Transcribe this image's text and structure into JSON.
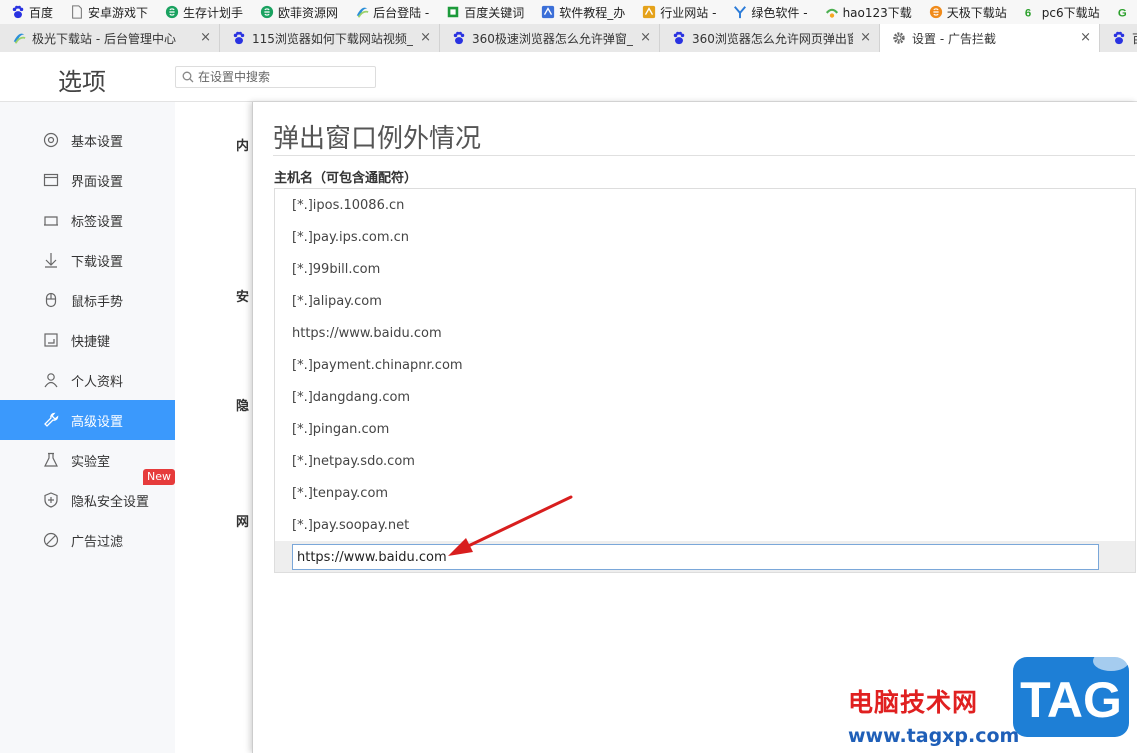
{
  "bookmarks": [
    {
      "label": "百度",
      "icon": "baidu-paw-icon",
      "color": "#2932e1"
    },
    {
      "label": "安卓游戏下",
      "icon": "page-icon",
      "color": "#888888"
    },
    {
      "label": "生存计划手",
      "icon": "site-e-icon",
      "color": "#1aa260"
    },
    {
      "label": "欧菲资源网",
      "icon": "site-e-icon",
      "color": "#1aa260"
    },
    {
      "label": "后台登陆 -",
      "icon": "aurora-icon",
      "color": "#2b8fd8"
    },
    {
      "label": "百度关键词",
      "icon": "crop-icon",
      "color": "#1c9a3a"
    },
    {
      "label": "软件教程_办",
      "icon": "site-icon",
      "color": "#3b6fd8"
    },
    {
      "label": "行业网站 -",
      "icon": "site-icon",
      "color": "#e5a21a"
    },
    {
      "label": "绿色软件 -",
      "icon": "site-y-icon",
      "color": "#2b7bd8"
    },
    {
      "label": "hao123下载",
      "icon": "hao123-icon",
      "color": "#4caf50"
    },
    {
      "label": "天极下载站",
      "icon": "site-e-icon",
      "color": "#f08a1a"
    },
    {
      "label": "pc6下载站",
      "icon": "pc6-icon",
      "color": "#2ca02c"
    },
    {
      "label": "",
      "icon": "site-g-icon",
      "color": "#2ca02c"
    }
  ],
  "tabs": [
    {
      "label": "极光下载站 - 后台管理中心",
      "icon": "aurora-icon",
      "active": false
    },
    {
      "label": "115浏览器如何下载网站视频_",
      "icon": "baidu-paw-icon",
      "active": false
    },
    {
      "label": "360极速浏览器怎么允许弹窗_",
      "icon": "baidu-paw-icon",
      "active": false
    },
    {
      "label": "360浏览器怎么允许网页弹出窗",
      "icon": "baidu-paw-icon",
      "active": false
    },
    {
      "label": "设置 - 广告拦截",
      "icon": "gear-icon",
      "active": true
    },
    {
      "label": "百度",
      "icon": "baidu-paw-icon",
      "active": false
    }
  ],
  "header": {
    "title": "选项",
    "search_placeholder": "在设置中搜索"
  },
  "sidebar": {
    "items": [
      {
        "label": "基本设置",
        "icon": "circle-settings-icon"
      },
      {
        "label": "界面设置",
        "icon": "window-icon"
      },
      {
        "label": "标签设置",
        "icon": "tab-icon"
      },
      {
        "label": "下载设置",
        "icon": "download-icon"
      },
      {
        "label": "鼠标手势",
        "icon": "mouse-icon"
      },
      {
        "label": "快捷键",
        "icon": "keyboard-icon"
      },
      {
        "label": "个人资料",
        "icon": "user-icon"
      },
      {
        "label": "高级设置",
        "icon": "wrench-icon",
        "active": true
      },
      {
        "label": "实验室",
        "icon": "flask-icon"
      },
      {
        "label": "隐私安全设置",
        "icon": "shield-icon"
      },
      {
        "label": "广告过滤",
        "icon": "block-icon"
      }
    ],
    "new_badge": "New"
  },
  "background_sections": [
    "内",
    "安",
    "隐",
    "网"
  ],
  "dialog": {
    "title": "弹出窗口例外情况",
    "column_header": "主机名（可包含通配符）",
    "hosts": [
      "[*.]ipos.10086.cn",
      "[*.]pay.ips.com.cn",
      "[*.]99bill.com",
      "[*.]alipay.com",
      "https://www.baidu.com",
      "[*.]payment.chinapnr.com",
      "[*.]dangdang.com",
      "[*.]pingan.com",
      "[*.]netpay.sdo.com",
      "[*.]tenpay.com",
      "[*.]pay.soopay.net"
    ],
    "new_entry_value": "https://www.baidu.com"
  },
  "watermark": {
    "text": "电脑技术网",
    "url": "www.tagxp.com",
    "logo": "TAG"
  }
}
